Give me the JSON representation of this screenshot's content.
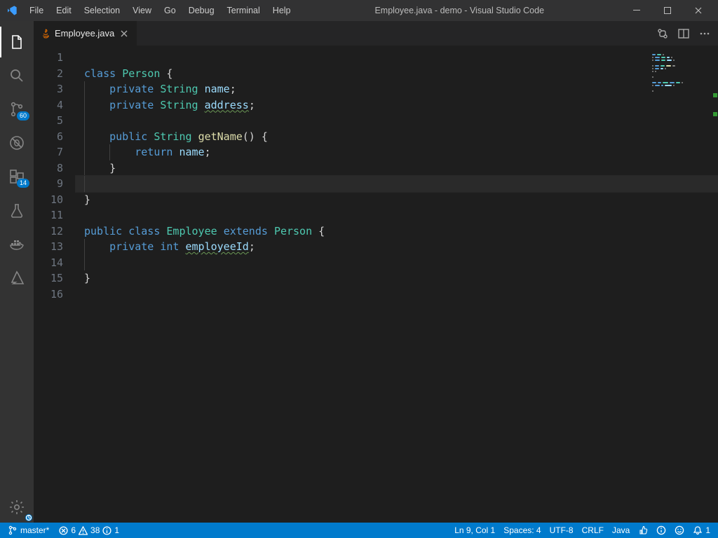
{
  "titlebar": {
    "menus": [
      "File",
      "Edit",
      "Selection",
      "View",
      "Go",
      "Debug",
      "Terminal",
      "Help"
    ],
    "title": "Employee.java - demo - Visual Studio Code"
  },
  "activitybar": {
    "scm_badge": "60",
    "java_badge": "14"
  },
  "tab": {
    "filename": "Employee.java"
  },
  "code": {
    "lines": [
      {
        "n": "1",
        "tokens": []
      },
      {
        "n": "2",
        "tokens": [
          [
            "kw1",
            "class "
          ],
          [
            "type",
            "Person "
          ],
          [
            "punct",
            "{"
          ]
        ]
      },
      {
        "n": "3",
        "tokens": [
          [
            "",
            "    "
          ],
          [
            "kw1",
            "private "
          ],
          [
            "type",
            "String "
          ],
          [
            "ident",
            "name"
          ],
          [
            "punct",
            ";"
          ]
        ],
        "g": [
          0
        ]
      },
      {
        "n": "4",
        "tokens": [
          [
            "",
            "    "
          ],
          [
            "kw1",
            "private "
          ],
          [
            "type",
            "String "
          ],
          [
            "ident sq-wavy",
            "address"
          ],
          [
            "punct",
            ";"
          ]
        ],
        "g": [
          0
        ]
      },
      {
        "n": "5",
        "tokens": [],
        "g": [
          0
        ]
      },
      {
        "n": "6",
        "tokens": [
          [
            "",
            "    "
          ],
          [
            "kw1",
            "public "
          ],
          [
            "type",
            "String "
          ],
          [
            "method",
            "getName"
          ],
          [
            "punct",
            "() {"
          ]
        ],
        "g": [
          0
        ]
      },
      {
        "n": "7",
        "tokens": [
          [
            "",
            "        "
          ],
          [
            "kw1",
            "return "
          ],
          [
            "ident",
            "name"
          ],
          [
            "punct",
            ";"
          ]
        ],
        "g": [
          0,
          1
        ]
      },
      {
        "n": "8",
        "tokens": [
          [
            "",
            "    "
          ],
          [
            "punct",
            "}"
          ]
        ],
        "g": [
          0
        ]
      },
      {
        "n": "9",
        "tokens": [],
        "g": [
          0
        ],
        "current": true
      },
      {
        "n": "10",
        "tokens": [
          [
            "punct",
            "}"
          ]
        ]
      },
      {
        "n": "11",
        "tokens": []
      },
      {
        "n": "12",
        "tokens": [
          [
            "kw1",
            "public "
          ],
          [
            "kw1",
            "class "
          ],
          [
            "type",
            "Employee "
          ],
          [
            "kw1",
            "extends "
          ],
          [
            "type",
            "Person "
          ],
          [
            "punct",
            "{"
          ]
        ]
      },
      {
        "n": "13",
        "tokens": [
          [
            "",
            "    "
          ],
          [
            "kw1",
            "private "
          ],
          [
            "kw1",
            "int "
          ],
          [
            "ident sq-wavy",
            "employeeId"
          ],
          [
            "punct",
            ";"
          ]
        ],
        "g": [
          0
        ]
      },
      {
        "n": "14",
        "tokens": [],
        "g": [
          0
        ]
      },
      {
        "n": "15",
        "tokens": [
          [
            "punct",
            "}"
          ]
        ]
      },
      {
        "n": "16",
        "tokens": []
      }
    ]
  },
  "status": {
    "branch": "master*",
    "errors": "6",
    "warnings": "38",
    "infos": "1",
    "cursor": "Ln 9, Col 1",
    "indent": "Spaces: 4",
    "encoding": "UTF-8",
    "eol": "CRLF",
    "lang": "Java",
    "notif": "1"
  }
}
